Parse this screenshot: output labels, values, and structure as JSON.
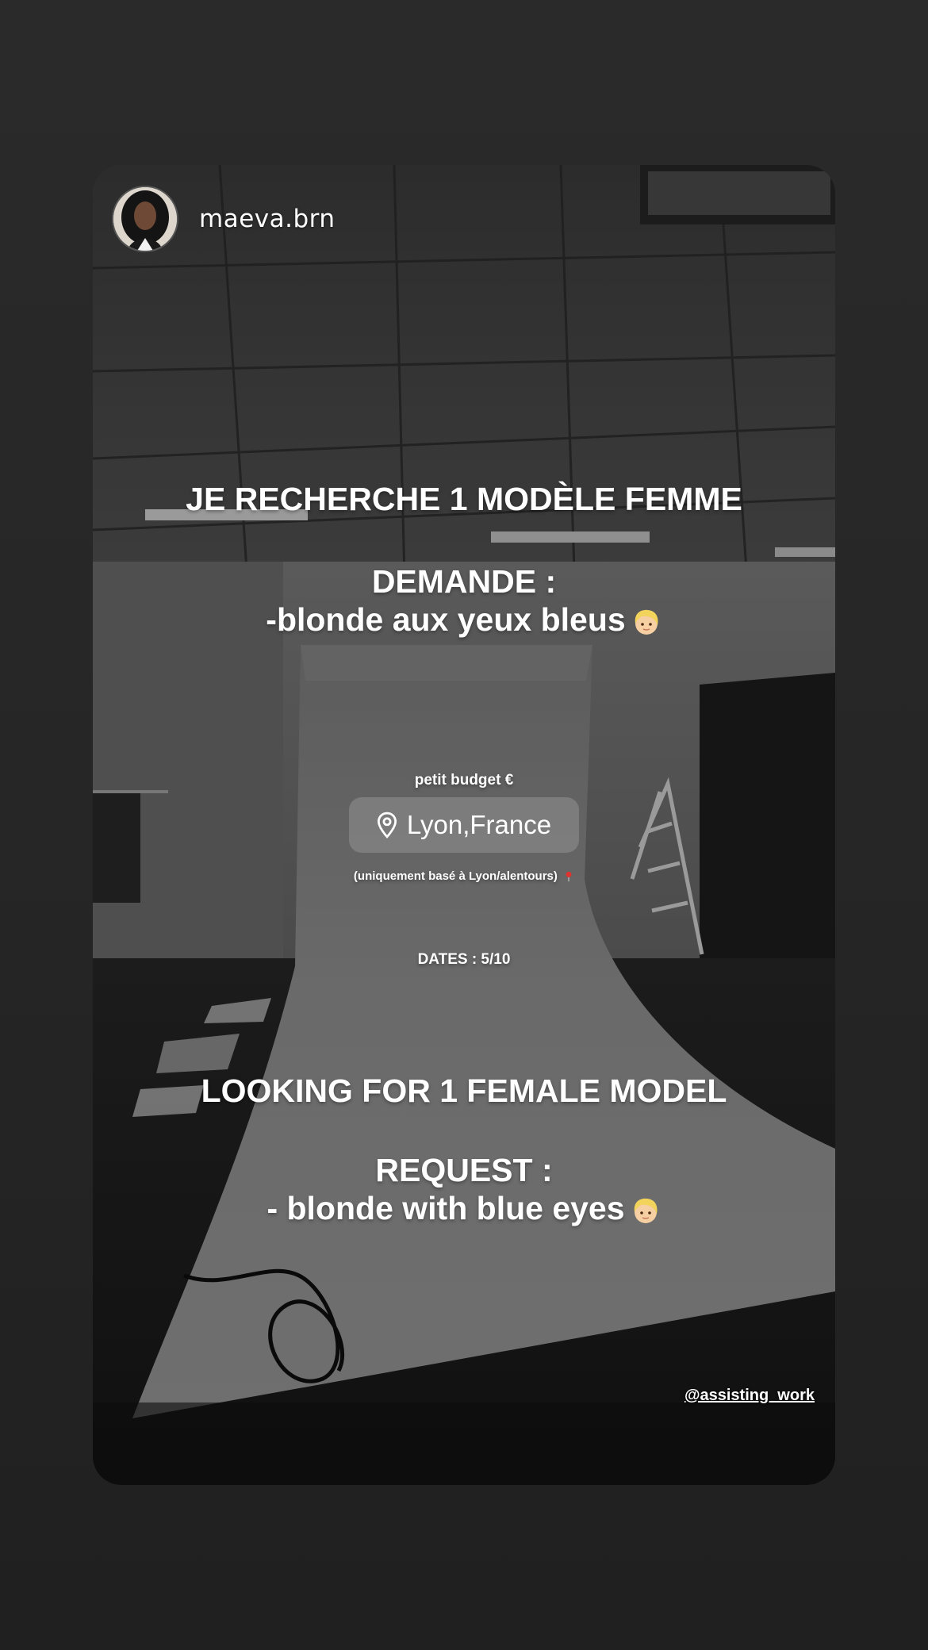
{
  "story": {
    "username": "maeva.brn",
    "line_fr_title": "JE RECHERCHE 1 MODÈLE FEMME",
    "line_fr_demande": "DEMANDE :",
    "line_fr_request": "-blonde aux yeux bleus",
    "budget": "petit budget €",
    "location": "Lyon,France",
    "location_note": "(uniquement basé à Lyon/alentours)",
    "dates": "DATES : 5/10",
    "line_en_title": "LOOKING FOR 1 FEMALE MODEL",
    "line_en_request_label": "REQUEST :",
    "line_en_request": "- blonde with blue eyes",
    "mention": "@assisting_work"
  },
  "icons": {
    "location": "location-pin-icon",
    "emoji": "blonde-person-emoji",
    "note": "red-pushpin-emoji"
  },
  "colors": {
    "page_bg": "#242424",
    "text": "#ffffff",
    "sticker_bg": "#8c8c8c"
  }
}
